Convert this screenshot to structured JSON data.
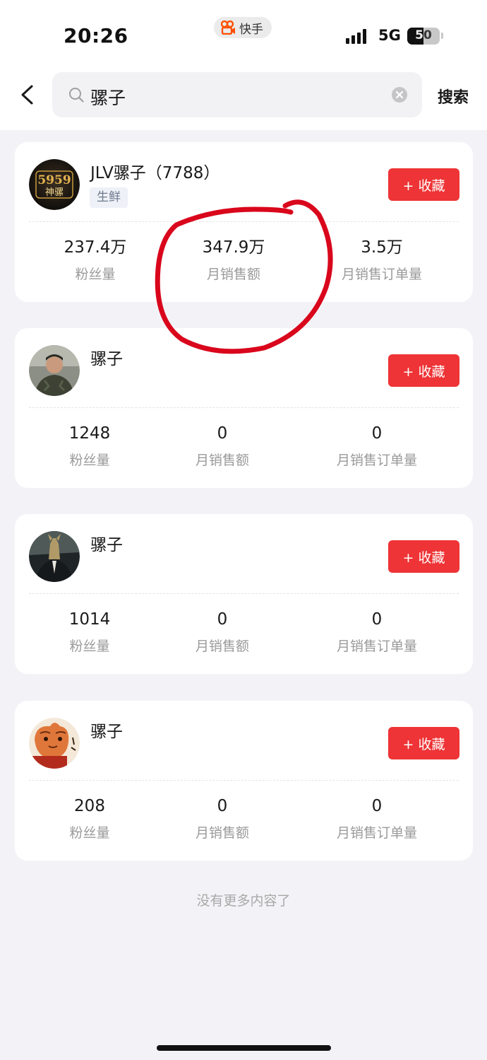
{
  "status_bar": {
    "time": "20:26",
    "app_name": "快手",
    "network": "5G",
    "battery_level": "50",
    "battery_fraction": 0.5,
    "accent_color": "#ff5000"
  },
  "search": {
    "query": "骡子",
    "search_button": "搜索",
    "icons": [
      "back-arrow",
      "search",
      "clear"
    ]
  },
  "cards": [
    {
      "name": "JLV骡子（7788）",
      "tag": "生鲜",
      "avatar_text": [
        "5959",
        "神骡"
      ],
      "collect_label": "+ 收藏",
      "stats": [
        {
          "value": "237.4万",
          "label": "粉丝量"
        },
        {
          "value": "347.9万",
          "label": "月销售额"
        },
        {
          "value": "3.5万",
          "label": "月销售订单量"
        }
      ]
    },
    {
      "name": "骡子",
      "tag": "",
      "collect_label": "+ 收藏",
      "stats": [
        {
          "value": "1248",
          "label": "粉丝量"
        },
        {
          "value": "0",
          "label": "月销售额"
        },
        {
          "value": "0",
          "label": "月销售订单量"
        }
      ]
    },
    {
      "name": "骡子",
      "tag": "",
      "collect_label": "+ 收藏",
      "stats": [
        {
          "value": "1014",
          "label": "粉丝量"
        },
        {
          "value": "0",
          "label": "月销售额"
        },
        {
          "value": "0",
          "label": "月销售订单量"
        }
      ]
    },
    {
      "name": "骡子",
      "tag": "",
      "collect_label": "+ 收藏",
      "stats": [
        {
          "value": "208",
          "label": "粉丝量"
        },
        {
          "value": "0",
          "label": "月销售额"
        },
        {
          "value": "0",
          "label": "月销售订单量"
        }
      ]
    }
  ],
  "footer": {
    "end_text": "没有更多内容了"
  },
  "colors": {
    "collect_button": "#ee3436",
    "annotation_circle": "#d9061c"
  }
}
